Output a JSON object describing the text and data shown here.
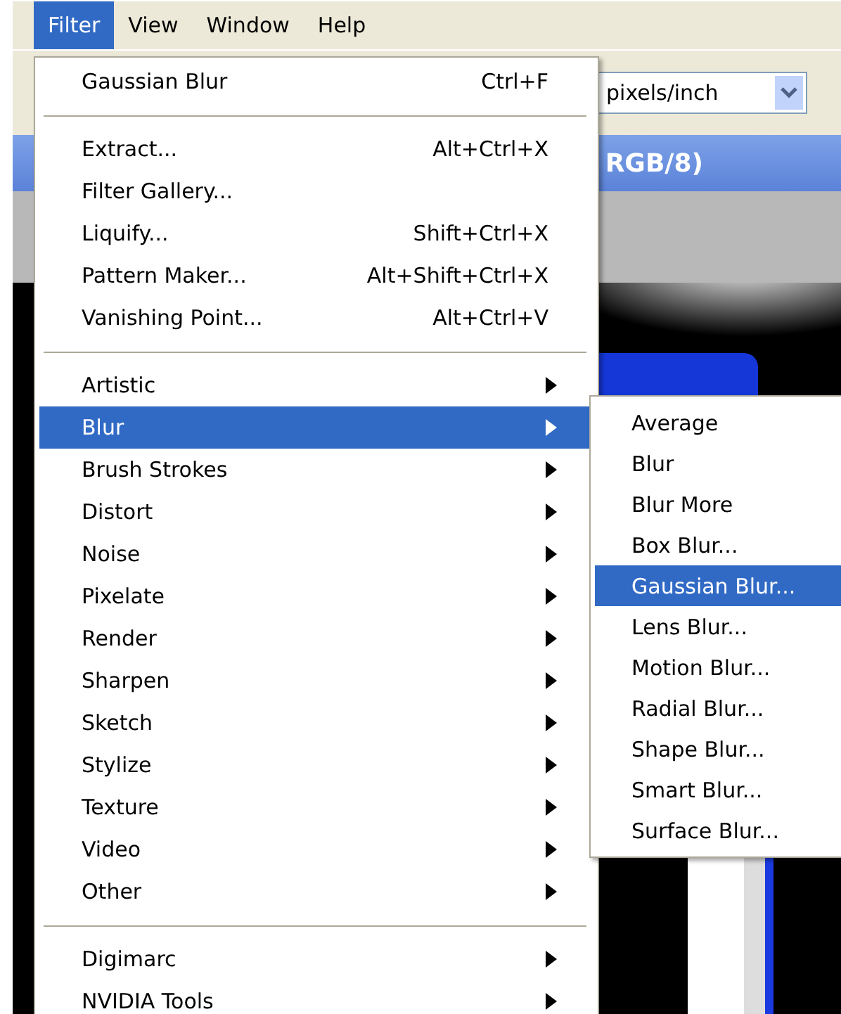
{
  "menubar": [
    {
      "label": "Filter",
      "selected": true
    },
    {
      "label": "View",
      "selected": false
    },
    {
      "label": "Window",
      "selected": false
    },
    {
      "label": "Help",
      "selected": false
    }
  ],
  "toolbar": {
    "resolution_unit": "pixels/inch"
  },
  "document": {
    "title": "RGB/8)"
  },
  "menu": {
    "sections": [
      [
        {
          "label": "Gaussian Blur",
          "shortcut": "Ctrl+F",
          "submenu": false,
          "selected": false
        }
      ],
      [
        {
          "label": "Extract...",
          "shortcut": "Alt+Ctrl+X",
          "submenu": false,
          "selected": false
        },
        {
          "label": "Filter Gallery...",
          "submenu": false,
          "selected": false
        },
        {
          "label": "Liquify...",
          "shortcut": "Shift+Ctrl+X",
          "submenu": false,
          "selected": false
        },
        {
          "label": "Pattern Maker...",
          "shortcut": "Alt+Shift+Ctrl+X",
          "submenu": false,
          "selected": false
        },
        {
          "label": "Vanishing Point...",
          "shortcut": "Alt+Ctrl+V",
          "submenu": false,
          "selected": false
        }
      ],
      [
        {
          "label": "Artistic",
          "submenu": true,
          "selected": false
        },
        {
          "label": "Blur",
          "submenu": true,
          "selected": true
        },
        {
          "label": "Brush Strokes",
          "submenu": true,
          "selected": false
        },
        {
          "label": "Distort",
          "submenu": true,
          "selected": false
        },
        {
          "label": "Noise",
          "submenu": true,
          "selected": false
        },
        {
          "label": "Pixelate",
          "submenu": true,
          "selected": false
        },
        {
          "label": "Render",
          "submenu": true,
          "selected": false
        },
        {
          "label": "Sharpen",
          "submenu": true,
          "selected": false
        },
        {
          "label": "Sketch",
          "submenu": true,
          "selected": false
        },
        {
          "label": "Stylize",
          "submenu": true,
          "selected": false
        },
        {
          "label": "Texture",
          "submenu": true,
          "selected": false
        },
        {
          "label": "Video",
          "submenu": true,
          "selected": false
        },
        {
          "label": "Other",
          "submenu": true,
          "selected": false
        }
      ],
      [
        {
          "label": "Digimarc",
          "submenu": true,
          "selected": false
        },
        {
          "label": "NVIDIA Tools",
          "submenu": true,
          "selected": false
        }
      ]
    ]
  },
  "submenu": {
    "items": [
      {
        "label": "Average",
        "selected": false
      },
      {
        "label": "Blur",
        "selected": false
      },
      {
        "label": "Blur More",
        "selected": false
      },
      {
        "label": "Box Blur...",
        "selected": false
      },
      {
        "label": "Gaussian Blur...",
        "selected": true
      },
      {
        "label": "Lens Blur...",
        "selected": false
      },
      {
        "label": "Motion Blur...",
        "selected": false
      },
      {
        "label": "Radial Blur...",
        "selected": false
      },
      {
        "label": "Shape Blur...",
        "selected": false
      },
      {
        "label": "Smart Blur...",
        "selected": false
      },
      {
        "label": "Surface Blur...",
        "selected": false
      }
    ]
  }
}
